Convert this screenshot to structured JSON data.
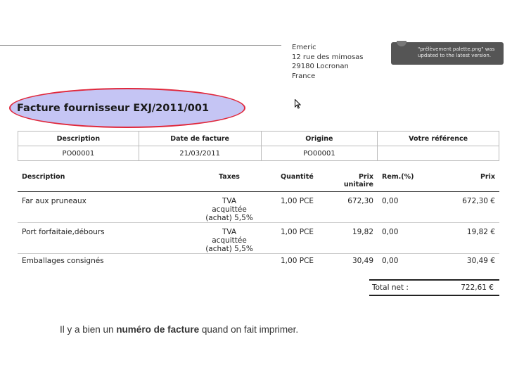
{
  "address": {
    "lines": [
      "Emeric",
      "12 rue des mimosas",
      "29180 Locronan",
      "France"
    ]
  },
  "notification": {
    "text": "\"prélèvement palette.png\" was updated to the latest version."
  },
  "invoice": {
    "title": "Facture fournisseur EXJ/2011/001",
    "header": {
      "columns": [
        "Description",
        "Date de facture",
        "Origine",
        "Votre référence"
      ],
      "values": [
        "PO00001",
        "21/03/2011",
        "PO00001",
        ""
      ]
    },
    "lines": {
      "columns": [
        "Description",
        "Taxes",
        "Quantité",
        "Prix unitaire",
        "Rem.(%)",
        "Prix"
      ],
      "rows": [
        {
          "description": "Far aux pruneaux",
          "taxes": "TVA acquittée (achat) 5,5%",
          "qty": "1,00 PCE",
          "unit_price": "672,30",
          "discount": "0,00",
          "price": "672,30 €"
        },
        {
          "description": "Port forfaitaie,débours",
          "taxes": "TVA acquittée (achat) 5,5%",
          "qty": "1,00 PCE",
          "unit_price": "19,82",
          "discount": "0,00",
          "price": "19,82 €"
        },
        {
          "description": "Emballages consignés",
          "taxes": "",
          "qty": "1,00 PCE",
          "unit_price": "30,49",
          "discount": "0,00",
          "price": "30,49 €"
        }
      ]
    },
    "total": {
      "label": "Total net :",
      "value": "722,61 €"
    }
  },
  "caption": {
    "before": "Il y a bien un ",
    "bold": "numéro de facture",
    "after": " quand on fait imprimer."
  },
  "colors": {
    "highlight_fill": "#c5c5f4",
    "highlight_border": "#e0283c"
  }
}
